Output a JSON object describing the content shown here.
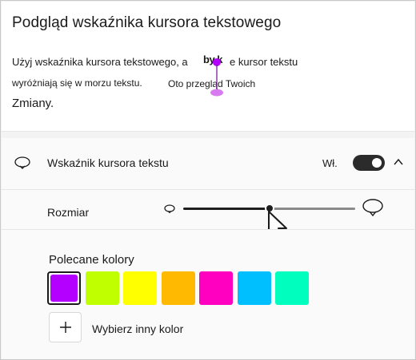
{
  "header": {
    "title": "Podgląd wskaźnika kursora tekstowego"
  },
  "preview": {
    "line1_left": "Użyj wskaźnika kursora tekstowego, a",
    "line1_right": "e kursor tekstu",
    "cursor_word": "by k",
    "line2": "wyróżniają się w morzu tekstu.",
    "overlay_text": "Oto przegląd Twoich",
    "line3": "Zmiany."
  },
  "indicator_row": {
    "label": "Wskaźnik kursora tekstu",
    "toggle_state": "Wł.",
    "toggle_on": true
  },
  "size_row": {
    "label": "Rozmiar",
    "slider_value_fraction": 0.5
  },
  "colors": {
    "heading": "Polecane kolory",
    "swatches": [
      "#b400ff",
      "#bfff00",
      "#ffff00",
      "#ffb900",
      "#ff00c0",
      "#00bfff",
      "#00ffbf"
    ],
    "selected_index": 0,
    "add_label": "Wybierz inny kolor"
  },
  "cursor_color": "#b400ff"
}
